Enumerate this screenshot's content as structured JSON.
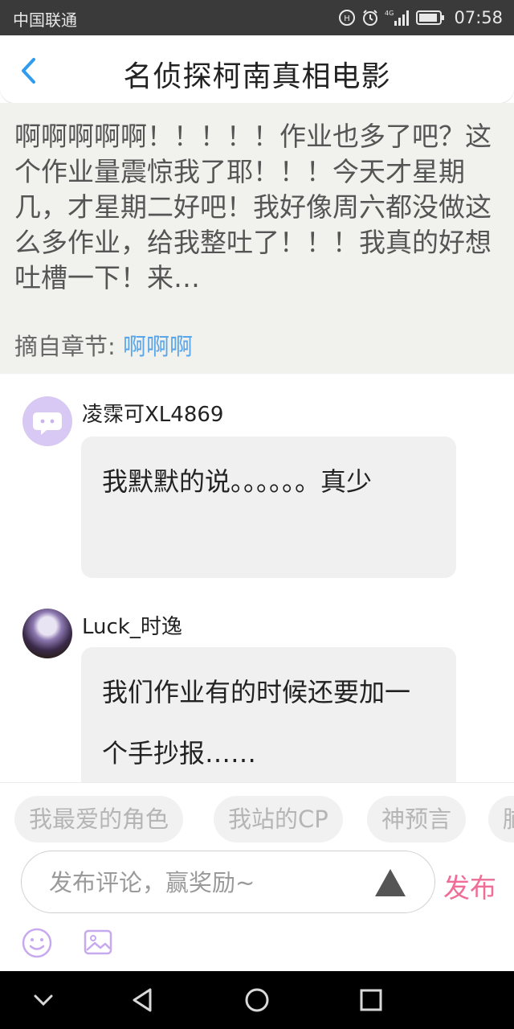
{
  "status_bar": {
    "carrier": "中国联通",
    "time": "07:58",
    "network": "4G",
    "icons": [
      "hd-icon",
      "alarm-icon",
      "signal-icon",
      "battery-icon"
    ]
  },
  "header": {
    "back_icon": "back-chevron-icon",
    "title": "名侦探柯南真相电影"
  },
  "quote": {
    "text": "啊啊啊啊啊！！！！！作业也多了吧？这个作业量震惊我了耶！！！今天才星期几，才星期二好吧！我好像周六都没做这么多作业，给我整吐了！！！我真的好想吐槽一下！来…",
    "chapter_label": "摘自章节:",
    "chapter_name": "啊啊啊"
  },
  "comments": [
    {
      "username": "凌霂可XL4869",
      "text": "我默默的说。。。。。。真少"
    },
    {
      "username": "Luck_时逸",
      "text": "我们作业有的时候还要加一个手抄报……"
    }
  ],
  "tags": [
    "我最爱的角色",
    "我站的CP",
    "神预言",
    "脑"
  ],
  "input": {
    "placeholder": "发布评论，赢奖励~",
    "publish_label": "发布"
  },
  "colors": {
    "accent_pink": "#ef6d97",
    "link_blue": "#5aa6e8",
    "back_blue": "#2f9cf0",
    "status_bar_bg": "#3a3a3a"
  }
}
